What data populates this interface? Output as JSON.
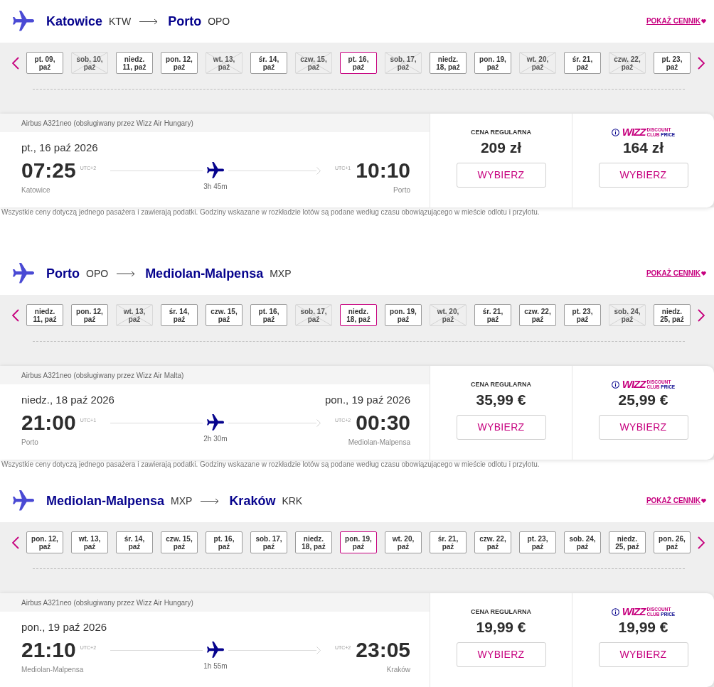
{
  "sections": [
    {
      "header": {
        "origin": {
          "city": "Katowice",
          "code": "KTW"
        },
        "destination": {
          "city": "Porto",
          "code": "OPO"
        },
        "link": "POKAŻ CENNIK"
      },
      "dates": [
        {
          "label": "pt. 09,\npaź",
          "selected": false,
          "disabled": false
        },
        {
          "label": "sob. 10,\npaź",
          "selected": false,
          "disabled": true
        },
        {
          "label": "niedz.\n11, paź",
          "selected": false,
          "disabled": false
        },
        {
          "label": "pon. 12,\npaź",
          "selected": false,
          "disabled": false
        },
        {
          "label": "wt. 13,\npaź",
          "selected": false,
          "disabled": true
        },
        {
          "label": "śr. 14,\npaź",
          "selected": false,
          "disabled": false
        },
        {
          "label": "czw. 15,\npaź",
          "selected": false,
          "disabled": true
        },
        {
          "label": "pt. 16,\npaź",
          "selected": true,
          "disabled": false
        },
        {
          "label": "sob. 17,\npaź",
          "selected": false,
          "disabled": true
        },
        {
          "label": "niedz.\n18, paź",
          "selected": false,
          "disabled": false
        },
        {
          "label": "pon. 19,\npaź",
          "selected": false,
          "disabled": false
        },
        {
          "label": "wt. 20,\npaź",
          "selected": false,
          "disabled": true
        },
        {
          "label": "śr. 21,\npaź",
          "selected": false,
          "disabled": false
        },
        {
          "label": "czw. 22,\npaź",
          "selected": false,
          "disabled": true
        },
        {
          "label": "pt. 23,\npaź",
          "selected": false,
          "disabled": false
        }
      ],
      "flight": {
        "aircraft": "Airbus A321neo (obsługiwany przez Wizz Air Hungary)",
        "departure": {
          "date": "pt., 16 paź 2026",
          "time": "07:25",
          "utc": "UTC+2",
          "city": "Katowice"
        },
        "duration": "3h 45m",
        "arrival": {
          "time": "10:10",
          "utc": "UTC+1",
          "city": "Porto"
        },
        "fares": [
          {
            "kind": "regular",
            "title": "CENA REGULARNA",
            "price": "209 zł",
            "button": "WYBIERZ"
          },
          {
            "kind": "club",
            "logo": {
              "wordmark": "WIZZ",
              "tagline": [
                "DISCOUNT",
                "CLUB",
                "PRICE"
              ]
            },
            "price": "164 zł",
            "button": "WYBIERZ"
          }
        ]
      },
      "note": "Wszystkie ceny dotyczą jednego pasażera i zawierają podatki. Godziny wskazane w rozkładzie lotów są podane według czasu obowiązującego w mieście odlotu i przylotu."
    },
    {
      "header": {
        "origin": {
          "city": "Porto",
          "code": "OPO"
        },
        "destination": {
          "city": "Mediolan-Malpensa",
          "code": "MXP"
        },
        "link": "POKAŻ CENNIK"
      },
      "dates": [
        {
          "label": "niedz.\n11, paź",
          "selected": false,
          "disabled": false
        },
        {
          "label": "pon. 12,\npaź",
          "selected": false,
          "disabled": false
        },
        {
          "label": "wt. 13,\npaź",
          "selected": false,
          "disabled": true
        },
        {
          "label": "śr. 14,\npaź",
          "selected": false,
          "disabled": false
        },
        {
          "label": "czw. 15,\npaź",
          "selected": false,
          "disabled": false
        },
        {
          "label": "pt. 16,\npaź",
          "selected": false,
          "disabled": false
        },
        {
          "label": "sob. 17,\npaź",
          "selected": false,
          "disabled": true
        },
        {
          "label": "niedz.\n18, paź",
          "selected": true,
          "disabled": false
        },
        {
          "label": "pon. 19,\npaź",
          "selected": false,
          "disabled": false
        },
        {
          "label": "wt. 20,\npaź",
          "selected": false,
          "disabled": true
        },
        {
          "label": "śr. 21,\npaź",
          "selected": false,
          "disabled": false
        },
        {
          "label": "czw. 22,\npaź",
          "selected": false,
          "disabled": false
        },
        {
          "label": "pt. 23,\npaź",
          "selected": false,
          "disabled": false
        },
        {
          "label": "sob. 24,\npaź",
          "selected": false,
          "disabled": true
        },
        {
          "label": "niedz.\n25, paź",
          "selected": false,
          "disabled": false
        }
      ],
      "flight": {
        "aircraft": "Airbus A321neo (obsługiwany przez Wizz Air Malta)",
        "departure": {
          "date": "niedz., 18 paź 2026",
          "time": "21:00",
          "utc": "UTC+1",
          "city": "Porto"
        },
        "duration": "2h 30m",
        "arrival": {
          "date": "pon., 19 paź 2026",
          "time": "00:30",
          "utc": "UTC+2",
          "city": "Mediolan-Malpensa"
        },
        "fares": [
          {
            "kind": "regular",
            "title": "CENA REGULARNA",
            "price": "35,99 €",
            "button": "WYBIERZ"
          },
          {
            "kind": "club",
            "logo": {
              "wordmark": "WIZZ",
              "tagline": [
                "DISCOUNT",
                "CLUB",
                "PRICE"
              ]
            },
            "price": "25,99 €",
            "button": "WYBIERZ"
          }
        ]
      },
      "note": "Wszystkie ceny dotyczą jednego pasażera i zawierają podatki. Godziny wskazane w rozkładzie lotów są podane według czasu obowiązującego w mieście odlotu i przylotu."
    },
    {
      "header": {
        "origin": {
          "city": "Mediolan-Malpensa",
          "code": "MXP"
        },
        "destination": {
          "city": "Kraków",
          "code": "KRK"
        },
        "link": "POKAŻ CENNIK"
      },
      "dates": [
        {
          "label": "pon. 12,\npaź",
          "selected": false,
          "disabled": false
        },
        {
          "label": "wt. 13,\npaź",
          "selected": false,
          "disabled": false
        },
        {
          "label": "śr. 14,\npaź",
          "selected": false,
          "disabled": false
        },
        {
          "label": "czw. 15,\npaź",
          "selected": false,
          "disabled": false
        },
        {
          "label": "pt. 16,\npaź",
          "selected": false,
          "disabled": false
        },
        {
          "label": "sob. 17,\npaź",
          "selected": false,
          "disabled": false
        },
        {
          "label": "niedz.\n18, paź",
          "selected": false,
          "disabled": false
        },
        {
          "label": "pon. 19,\npaź",
          "selected": true,
          "disabled": false
        },
        {
          "label": "wt. 20,\npaź",
          "selected": false,
          "disabled": false
        },
        {
          "label": "śr. 21,\npaź",
          "selected": false,
          "disabled": false
        },
        {
          "label": "czw. 22,\npaź",
          "selected": false,
          "disabled": false
        },
        {
          "label": "pt. 23,\npaź",
          "selected": false,
          "disabled": false
        },
        {
          "label": "sob. 24,\npaź",
          "selected": false,
          "disabled": false
        },
        {
          "label": "niedz.\n25, paź",
          "selected": false,
          "disabled": false
        },
        {
          "label": "pon. 26,\npaź",
          "selected": false,
          "disabled": false
        }
      ],
      "flight": {
        "aircraft": "Airbus A321neo (obsługiwany przez Wizz Air Hungary)",
        "departure": {
          "date": "pon., 19 paź 2026",
          "time": "21:10",
          "utc": "UTC+2",
          "city": "Mediolan-Malpensa"
        },
        "duration": "1h 55m",
        "arrival": {
          "time": "23:05",
          "utc": "UTC+2",
          "city": "Kraków"
        },
        "fares": [
          {
            "kind": "regular",
            "title": "CENA REGULARNA",
            "price": "19,99 €",
            "button": "WYBIERZ"
          },
          {
            "kind": "club",
            "logo": {
              "wordmark": "WIZZ",
              "tagline": [
                "DISCOUNT",
                "CLUB",
                "PRICE"
              ]
            },
            "price": "19,99 €",
            "button": "WYBIERZ"
          }
        ]
      }
    }
  ]
}
